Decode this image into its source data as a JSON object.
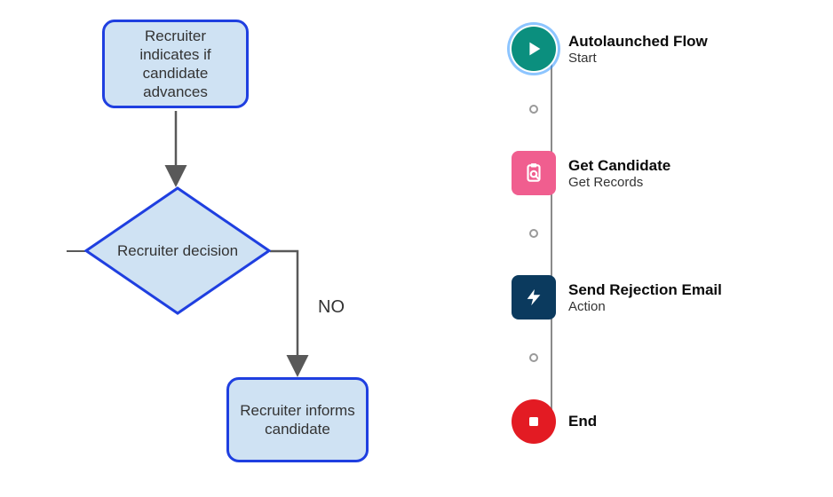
{
  "left_flowchart": {
    "box1_text": "Recruiter indicates if candidate advances",
    "decision_text": "Recruiter decision",
    "no_label": "NO",
    "box2_text": "Recruiter informs candidate"
  },
  "right_flow": {
    "nodes": [
      {
        "title": "Autolaunched Flow",
        "subtitle": "Start",
        "shape": "circle",
        "bg": "#0b8f7e",
        "icon": "play"
      },
      {
        "title": "Get Candidate",
        "subtitle": "Get Records",
        "shape": "round",
        "bg": "#f05e8f",
        "icon": "clipboard"
      },
      {
        "title": "Send Rejection Email",
        "subtitle": "Action",
        "shape": "round",
        "bg": "#0b3a5e",
        "icon": "bolt"
      },
      {
        "title": "End",
        "subtitle": "",
        "shape": "circle",
        "bg": "#e31b23",
        "icon": "stop"
      }
    ]
  }
}
